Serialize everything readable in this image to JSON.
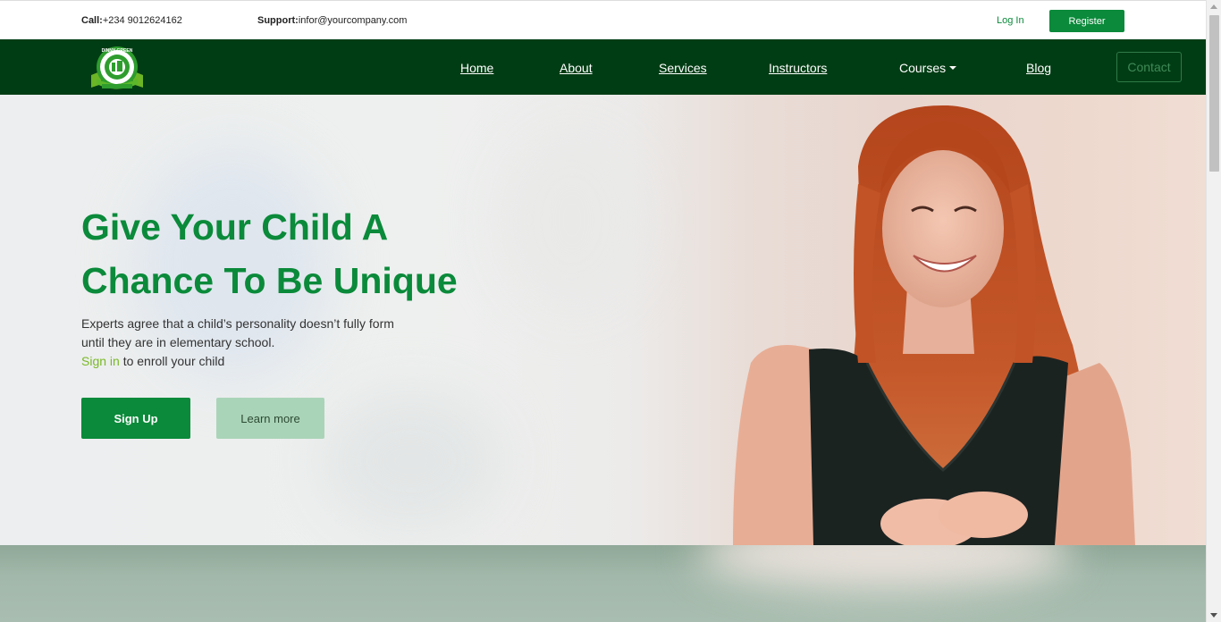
{
  "topbar": {
    "call_label": "Call:",
    "call_value": "+234 9012624162",
    "support_label": "Support:",
    "support_value": "infor@yourcompany.com",
    "login": "Log In",
    "register": "Register"
  },
  "navbar": {
    "logo_text": "DINNY GREEN",
    "items": [
      {
        "label": "Home"
      },
      {
        "label": "About"
      },
      {
        "label": "Services"
      },
      {
        "label": "Instructors"
      },
      {
        "label": "Courses"
      },
      {
        "label": "Blog"
      }
    ],
    "contact": "Contact"
  },
  "hero": {
    "title_line1": "Give Your Child A",
    "title_line2": "Chance To Be Unique",
    "desc_line1": "Experts agree that a child’s personality doesn’t fully form",
    "desc_line2": "until they are in elementary school.",
    "sign_in": "Sign in",
    "enroll": " to enroll your child",
    "signup_button": "Sign Up",
    "learn_button": "Learn more"
  },
  "colors": {
    "brand_green": "#0a8a3a",
    "nav_dark_green": "#013d14",
    "sign_in_green": "#7ab826"
  }
}
